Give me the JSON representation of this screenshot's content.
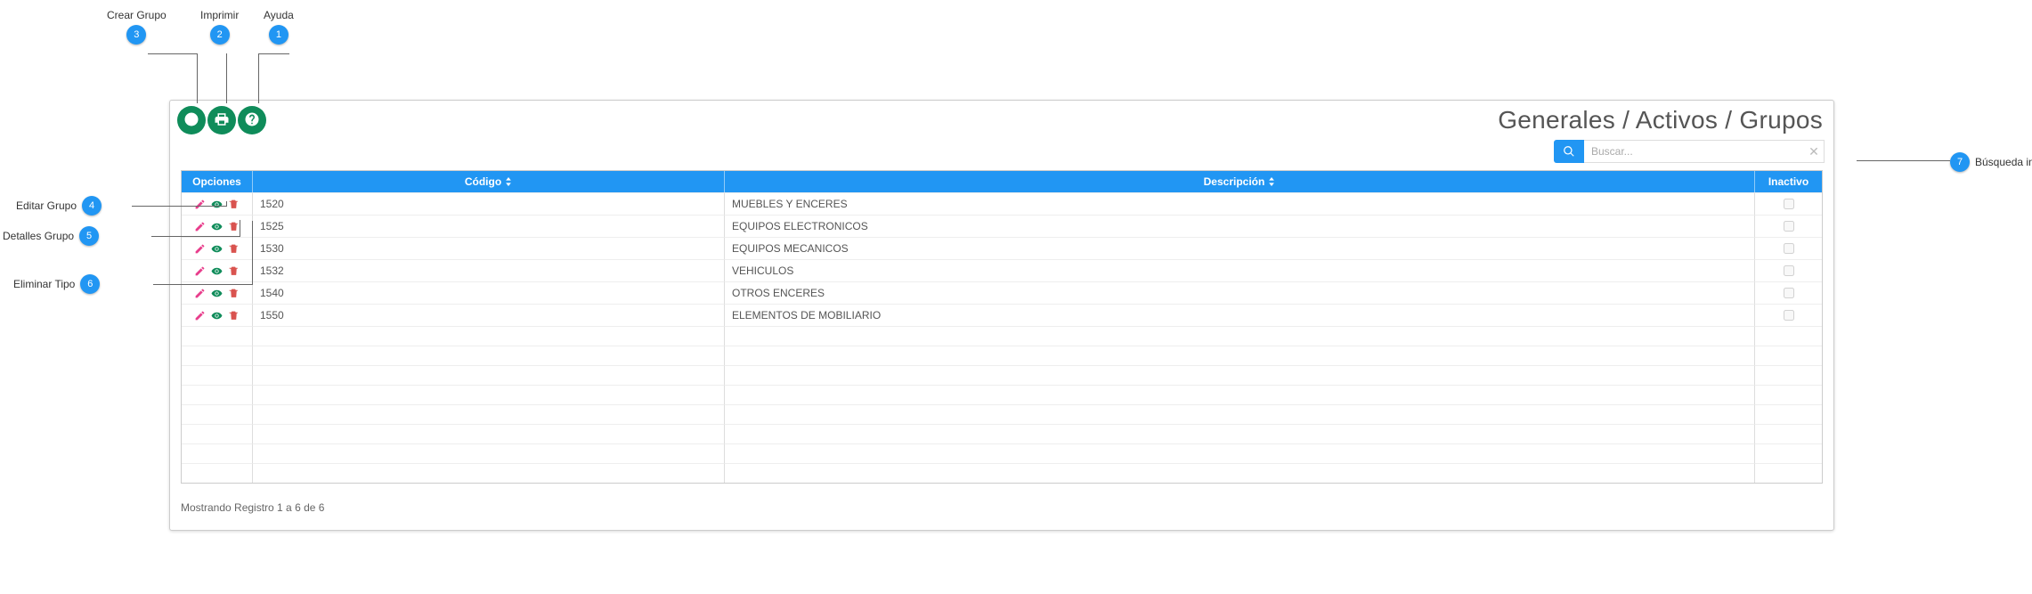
{
  "breadcrumb": "Generales / Activos / Grupos",
  "search": {
    "placeholder": "Buscar..."
  },
  "columns": {
    "opciones": "Opciones",
    "codigo": "Código",
    "descripcion": "Descripción",
    "inactivo": "Inactivo"
  },
  "rows": [
    {
      "codigo": "1520",
      "descripcion": "MUEBLES Y ENCERES"
    },
    {
      "codigo": "1525",
      "descripcion": "EQUIPOS ELECTRONICOS"
    },
    {
      "codigo": "1530",
      "descripcion": "EQUIPOS MECANICOS"
    },
    {
      "codigo": "1532",
      "descripcion": "VEHICULOS"
    },
    {
      "codigo": "1540",
      "descripcion": "OTROS ENCERES"
    },
    {
      "codigo": "1550",
      "descripcion": "ELEMENTOS DE MOBILIARIO"
    }
  ],
  "empty_rows": 8,
  "footer": "Mostrando Registro 1 a 6 de 6",
  "callouts": {
    "c1": {
      "n": "1",
      "label": "Ayuda"
    },
    "c2": {
      "n": "2",
      "label": "Imprimir"
    },
    "c3": {
      "n": "3",
      "label": "Crear Grupo"
    },
    "c4": {
      "n": "4",
      "label": "Editar Grupo"
    },
    "c5": {
      "n": "5",
      "label": "Detalles Grupo"
    },
    "c6": {
      "n": "6",
      "label": "Eliminar Tipo"
    },
    "c7": {
      "n": "7",
      "label": "Búsqueda interactiva"
    }
  }
}
